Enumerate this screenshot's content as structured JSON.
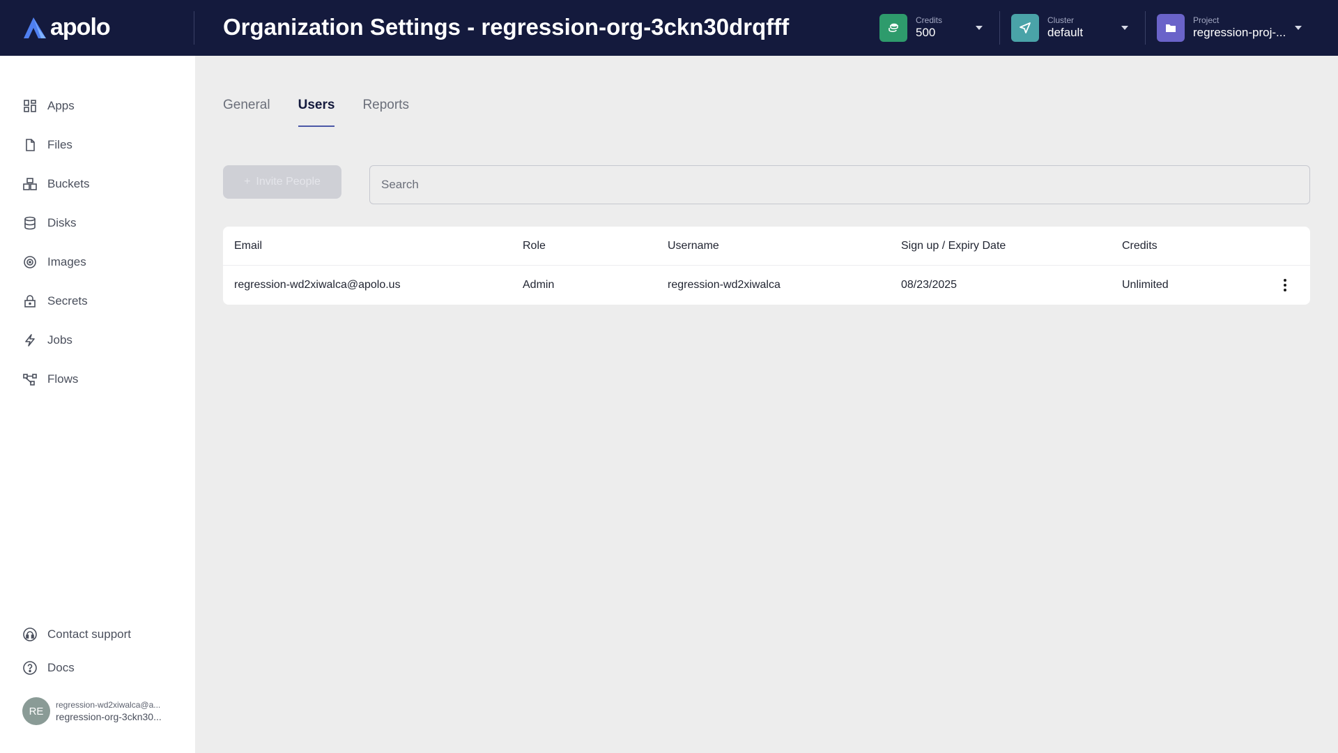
{
  "brand": {
    "name": "apolo"
  },
  "header": {
    "title": "Organization Settings - regression-org-3ckn30drqfff",
    "credits": {
      "label": "Credits",
      "value": "500",
      "color": "#2e9b6c"
    },
    "cluster": {
      "label": "Cluster",
      "value": "default",
      "color": "#4aa3a8"
    },
    "project": {
      "label": "Project",
      "value": "regression-proj-...",
      "color": "#6a63c9"
    }
  },
  "sidebar": {
    "items": [
      {
        "label": "Apps",
        "icon": "grid-icon"
      },
      {
        "label": "Files",
        "icon": "file-icon"
      },
      {
        "label": "Buckets",
        "icon": "bucket-icon"
      },
      {
        "label": "Disks",
        "icon": "database-icon"
      },
      {
        "label": "Images",
        "icon": "image-icon"
      },
      {
        "label": "Secrets",
        "icon": "lock-icon"
      },
      {
        "label": "Jobs",
        "icon": "bolt-icon"
      },
      {
        "label": "Flows",
        "icon": "flow-icon"
      }
    ],
    "footer": [
      {
        "label": "Contact support",
        "icon": "headset-icon"
      },
      {
        "label": "Docs",
        "icon": "help-icon"
      }
    ],
    "user": {
      "initials": "RE",
      "email": "regression-wd2xiwalca@a...",
      "org": "regression-org-3ckn30..."
    }
  },
  "tabs": [
    {
      "label": "General",
      "active": false
    },
    {
      "label": "Users",
      "active": true
    },
    {
      "label": "Reports",
      "active": false
    }
  ],
  "toolbar": {
    "invite_label": "Invite People",
    "search_placeholder": "Search"
  },
  "users_table": {
    "columns": [
      "Email",
      "Role",
      "Username",
      "Sign up / Expiry Date",
      "Credits"
    ],
    "rows": [
      [
        "regression-wd2xiwalca@apolo.us",
        "Admin",
        "regression-wd2xiwalca",
        "08/23/2025",
        "Unlimited"
      ]
    ]
  }
}
